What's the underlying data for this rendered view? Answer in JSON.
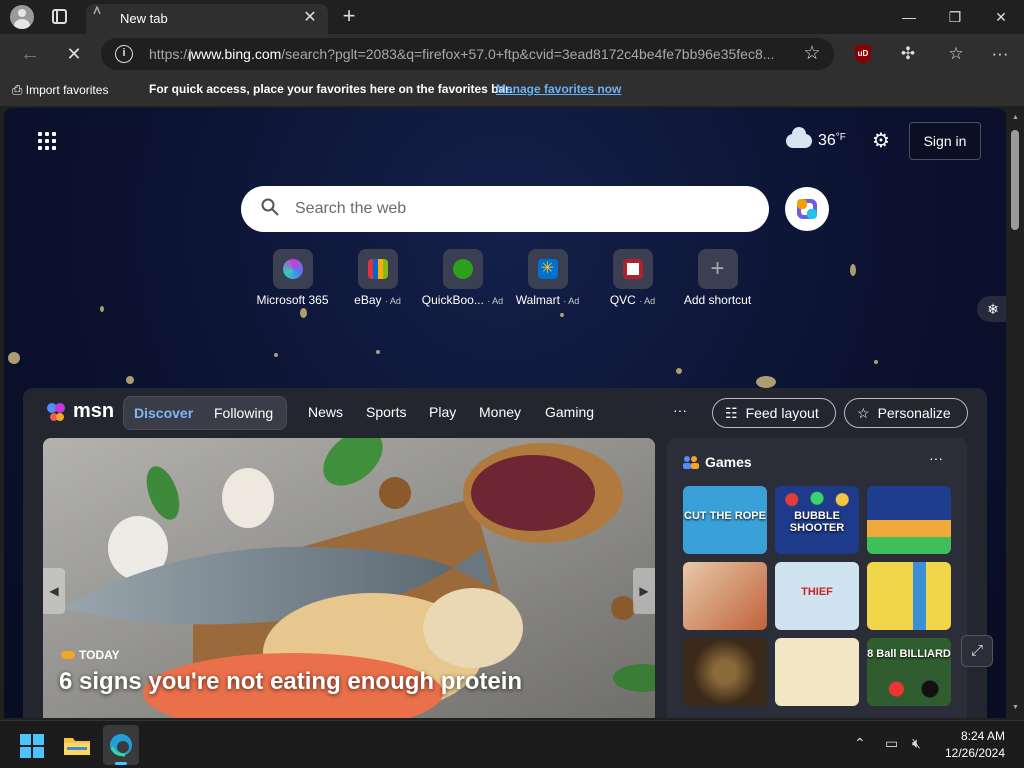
{
  "browser": {
    "tab_title": "New tab",
    "url_prefix": "https://",
    "url_host": "www.bing.com",
    "url_rest": "/search?pglt=2083&q=firefox+57.0+ftp&cvid=3ead8172c4be4fe7bb96e35fec8...",
    "favorites_bar": {
      "import_label": "Import favorites",
      "message": "For quick access, place your favorites here on the favorites bar.",
      "manage_link": "Manage favorites now"
    }
  },
  "newtab": {
    "weather": {
      "temp": "36",
      "unit": "°F"
    },
    "sign_in": "Sign in",
    "search": {
      "placeholder": "Search the web"
    },
    "shortcuts": [
      {
        "label": "Microsoft 365",
        "ad": ""
      },
      {
        "label": "eBay",
        "ad": "· Ad"
      },
      {
        "label": "QuickBoo...",
        "ad": "· Ad"
      },
      {
        "label": "Walmart",
        "ad": "· Ad"
      },
      {
        "label": "QVC",
        "ad": "· Ad"
      },
      {
        "label": "Add shortcut",
        "ad": ""
      }
    ]
  },
  "feed": {
    "brand": "msn",
    "tabs": {
      "discover": "Discover",
      "following": "Following"
    },
    "nav": [
      "News",
      "Sports",
      "Play",
      "Money",
      "Gaming"
    ],
    "more": "···",
    "feed_layout": "Feed layout",
    "personalize": "Personalize",
    "hero": {
      "source": "TODAY",
      "title": "6 signs you're not eating enough protein"
    },
    "games": {
      "title": "Games",
      "more": "···",
      "items": [
        {
          "label": "CUT THE ROPE",
          "color": "#3aa0d8"
        },
        {
          "label": "BUBBLE SHOOTER",
          "color": "#1e3a8a"
        },
        {
          "label": "",
          "color": "#1f3d8f"
        },
        {
          "label": "",
          "color": "#e8c9a8"
        },
        {
          "label": "THIEF",
          "color": "#cfe3f0"
        },
        {
          "label": "",
          "color": "#f2d64a"
        },
        {
          "label": "",
          "color": "#3b2a1a"
        },
        {
          "label": "",
          "color": "#f3e6c4"
        },
        {
          "label": "8 Ball BILLIARD",
          "color": "#2f5d2f"
        }
      ]
    }
  },
  "taskbar": {
    "time": "8:24 AM",
    "date": "12/26/2024"
  },
  "colors": {
    "accent": "#4cc2ff",
    "link": "#6ab2f7",
    "discover": "#7fb7f5"
  }
}
